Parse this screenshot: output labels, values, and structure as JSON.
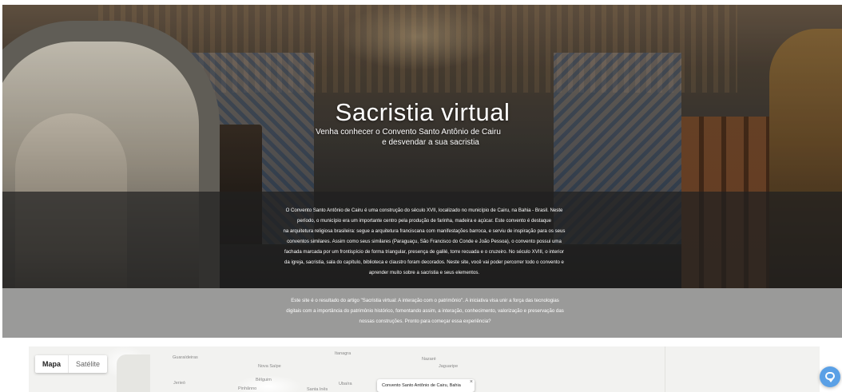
{
  "hero": {
    "title": "Sacristia virtual",
    "subtitle_line1": "Venha conhecer o Convento Santo Antônio de Cairu",
    "subtitle_line2": "e desvendar a sua sacristia"
  },
  "intro": {
    "lines": [
      "O Convento Santo Antônio de Cairu é uma construção do século XVII, localizado no município de Cairu, na Bahia - Brasil. Neste",
      "período, o município era um importante centro pela produção de farinha, madeira e açúcar. Este convento é destaque",
      "na arquitetura religiosa brasileira: segue a arquitetura franciscana com manifestações barroca, e serviu de inspiração para os seus",
      "conventos similares. Assim como seus similares (Paraguaçu, São Francisco do Conde e  João Pessoa),  o convento possui uma",
      "fachada marcada por um frontispício de forma triangular, presença de galilé, torre recuada e o cruzeiro. No século XVIII, o interior",
      "da igreja, sacristia, sala do capítulo, biblioteca e claustro foram decorados.  Neste site, você vai poder percorrer todo o convento e",
      "aprender muito sobre a sacristia e seus elementos."
    ]
  },
  "about": {
    "lines": [
      "Este site é o resultado do artigo \"Sacristia virtual: A interação com o patrimônio\". A iniciativa visa unir a força das tecnologias",
      "digitais com a importância do patrimônio histórico, fomentando assim, a interação, conhecimento, valorização e preservação das",
      "nossas construções. Pronto para começar essa experiência?"
    ]
  },
  "map": {
    "toggle": {
      "map_label": "Mapa",
      "satellite_label": "Satélite"
    },
    "place_labels": [
      "Guaraídeiras",
      "Nova Saípe",
      "Nazaré",
      "Jaguaripe",
      "Bêlguim",
      "Jerieó",
      "Pinhãnno",
      "Ubaíra",
      "Santa Inês",
      "Itanagra"
    ],
    "info_window": {
      "title": "Convento Santo Antônio de Cairu, Bahia",
      "close": "×"
    }
  },
  "chat": {
    "icon": "chat-bubble-icon"
  }
}
